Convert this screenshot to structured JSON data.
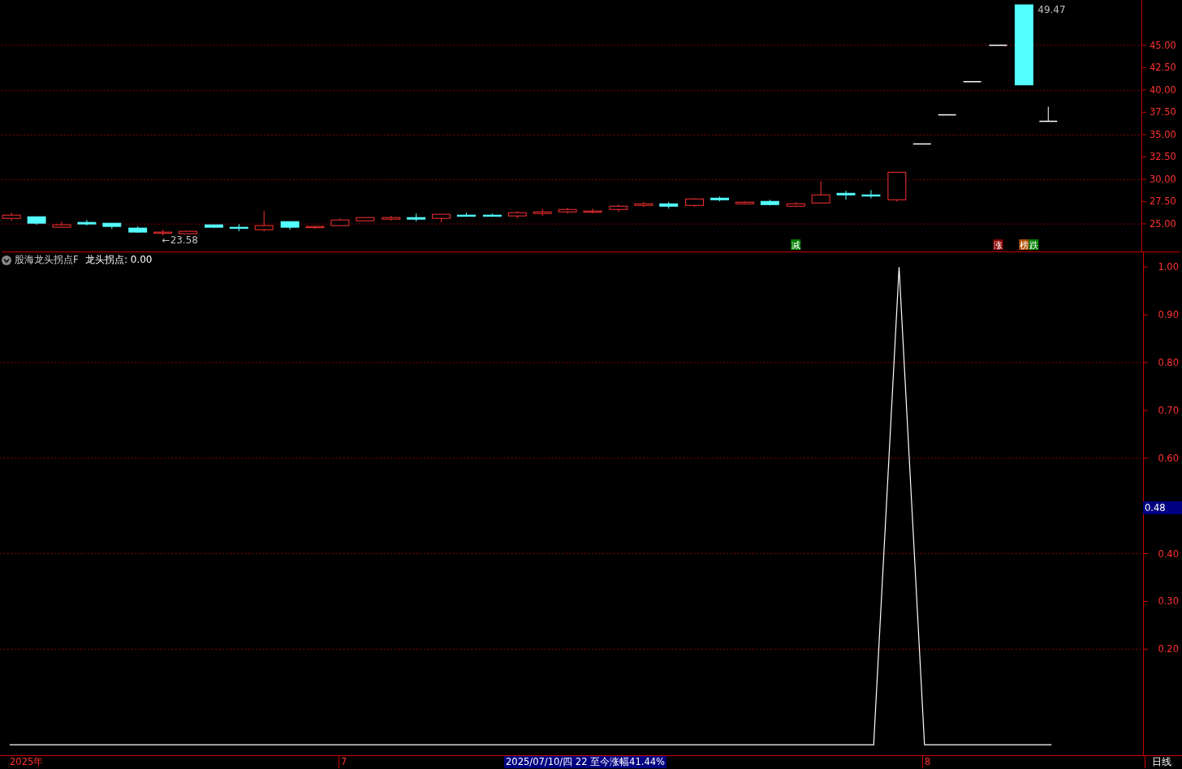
{
  "price_panel": {
    "axis_ticks": [
      "45.00",
      "42.50",
      "40.00",
      "37.50",
      "35.00",
      "32.50",
      "30.00",
      "27.50",
      "25.00"
    ],
    "low_label": "←23.58",
    "high_label": "49.47",
    "signals": [
      {
        "text": "减",
        "color": "#008000"
      },
      {
        "text": "涨",
        "color": "#8b0000"
      },
      {
        "text": "榜",
        "color": "#b05000"
      },
      {
        "text": "跌",
        "color": "#008000"
      }
    ]
  },
  "indicator_panel": {
    "title": "股海龙头拐点F",
    "readout_suffix": ": 0.00",
    "cursor_value": "0.48",
    "chart_data": {
      "type": "line",
      "ylim": [
        -0.022,
        1.031
      ],
      "grid": true,
      "yticks": [
        {
          "value": 0.2,
          "label": "0.20"
        },
        {
          "value": 0.3,
          "label": "0.30"
        },
        {
          "value": 0.4,
          "label": "0.40"
        },
        {
          "value": 0.6,
          "label": "0.60"
        },
        {
          "value": 0.7,
          "label": "0.70"
        },
        {
          "value": 0.8,
          "label": "0.80"
        },
        {
          "value": 0.9,
          "label": "0.90"
        },
        {
          "value": 1.0,
          "label": "1.00"
        }
      ],
      "series": [
        {
          "name": "龙头拐点",
          "color": "#ffffff",
          "values": [
            0,
            0,
            0,
            0,
            0,
            0,
            0,
            0,
            0,
            0,
            0,
            0,
            0,
            0,
            0,
            0,
            0,
            0,
            0,
            0,
            0,
            0,
            0,
            0,
            0,
            0,
            0,
            0,
            0,
            0,
            0,
            0,
            0,
            0,
            0,
            1,
            0,
            0,
            0,
            0,
            0,
            0
          ]
        }
      ]
    }
  },
  "time_axis": {
    "year": "2025年",
    "month_1": "7",
    "cursor_info": "2025/07/10/四 22 至今涨幅41.44%",
    "month_2": "8",
    "period": "日线"
  }
}
